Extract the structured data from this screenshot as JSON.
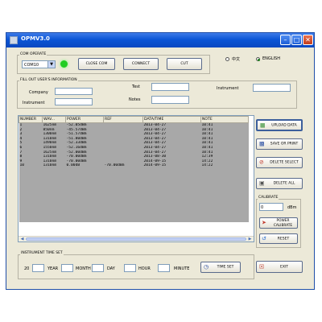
{
  "window": {
    "title": "OPMV3.0"
  },
  "com_operate": {
    "group_title": "COM OPERATE",
    "port_value": "COM10",
    "close_com": "CLOSE COM",
    "connect": "CONNECT",
    "cut": "CUT",
    "status_color": "#22cc22"
  },
  "language": {
    "option_chinese": "中文",
    "option_english": "ENGLISH",
    "selected": "ENGLISH"
  },
  "user_info": {
    "group_title": "FILL OUT USER'S INFORMATION",
    "company_label": "Company",
    "test_label": "Test",
    "instrument_label": "Instrument",
    "instrument2_label": "Instrument",
    "notes_label": "Notes"
  },
  "table": {
    "columns": [
      "NUMBER",
      "WAV...",
      "POWER",
      "REF",
      "DATA/TIME",
      "NOTE"
    ],
    "rows": [
      [
        "1",
        "1625nm",
        "-52.05dBm",
        "",
        "2013-04-27",
        "10:41"
      ],
      [
        "2",
        "850nm",
        "-45.57dBm",
        "",
        "2013-04-27",
        "10:41"
      ],
      [
        "3",
        "1300nm",
        "-51.57dBm",
        "",
        "2013-04-27",
        "10:41"
      ],
      [
        "4",
        "1310nm",
        "-51.80dBm",
        "",
        "2013-04-27",
        "10:41"
      ],
      [
        "5",
        "1490nm",
        "-52.33dBm",
        "",
        "2013-04-27",
        "10:41"
      ],
      [
        "6",
        "1550nm",
        "-52.16dBm",
        "",
        "2013-04-27",
        "10:41"
      ],
      [
        "7",
        "1625nm",
        "-52.00dBm",
        "",
        "2013-04-27",
        "10:41"
      ],
      [
        "8",
        "1310nm",
        "-70.00dBm",
        "",
        "2013-08-30",
        "12:39"
      ],
      [
        "9",
        "1310nm",
        "-70.00dBm",
        "",
        "2014-09-15",
        "14:22"
      ],
      [
        "10",
        "1310nm",
        "0.00dB",
        "-70.00dBm",
        "2014-09-15",
        "14:22"
      ]
    ]
  },
  "side_buttons": {
    "upload": "UPLOAD DATA",
    "save": "SAVE OR PRINT",
    "delete_select": "DELETE SELECT",
    "delete_all": "DELETE ALL"
  },
  "calibrate": {
    "group_title": "CALIBRATE",
    "value": "0",
    "unit": "dBm",
    "power_calibrate_line1": "POWER",
    "power_calibrate_line2": "CALIBRATE",
    "reset": "RESET"
  },
  "time_set": {
    "group_title": "INSTRUMENT TIME SET",
    "year_prefix": "20",
    "year_label": "YEAR",
    "month_label": "MONTH",
    "day_label": "DAY",
    "hour_label": "HOUR",
    "minute_label": "MINUTE",
    "button": "TIME SET"
  },
  "exit": {
    "label": "EXIT"
  },
  "icons": {
    "upload": "upload-icon",
    "save": "floppy-disk-icon",
    "delete_select": "delete-select-icon",
    "delete_all": "trash-icon",
    "power_calibrate": "power-calibrate-icon",
    "reset": "reset-icon",
    "time_set": "clock-icon",
    "exit": "exit-icon"
  }
}
